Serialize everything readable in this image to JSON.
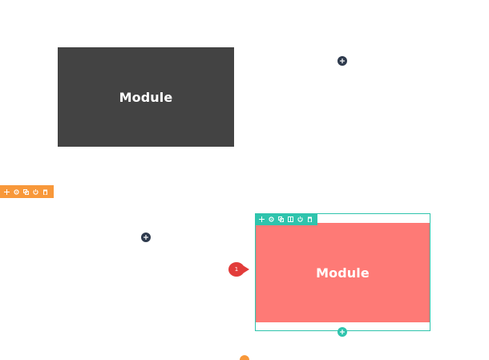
{
  "modules": {
    "top_module_label": "Module",
    "bottom_module_label": "Module"
  },
  "badge": {
    "count": "1"
  },
  "colors": {
    "gray_module": "#434343",
    "red_module": "#fe7a76",
    "section_toolbar": "#f8983a",
    "row_toolbar": "#2fc4ad",
    "add_dot_dark": "#2e3a4d",
    "badge": "#e23c3a"
  },
  "icons": {
    "section_toolbar": [
      "move-icon",
      "settings-icon",
      "duplicate-icon",
      "power-icon",
      "trash-icon"
    ],
    "row_toolbar": [
      "move-icon",
      "settings-icon",
      "duplicate-icon",
      "columns-icon",
      "power-icon",
      "trash-icon"
    ],
    "add": "plus-icon"
  }
}
